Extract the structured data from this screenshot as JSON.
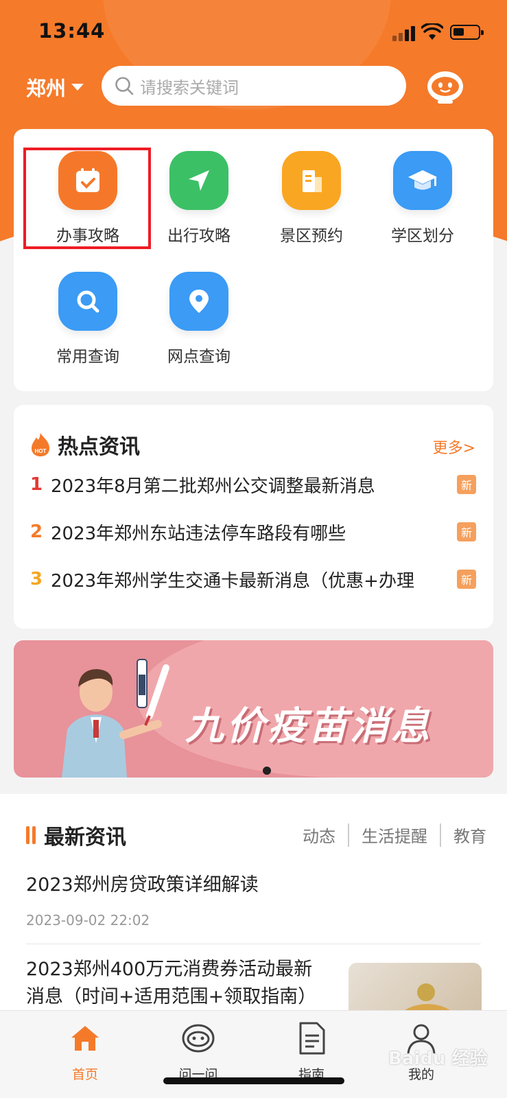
{
  "status": {
    "time": "13:44"
  },
  "header": {
    "city": "郑州",
    "search_placeholder": "请搜索关键词"
  },
  "services": [
    {
      "label": "办事攻略",
      "icon": "calendar-check-icon",
      "color": "#f5782a"
    },
    {
      "label": "出行攻略",
      "icon": "navigation-arrow-icon",
      "color": "#3cc066"
    },
    {
      "label": "景区预约",
      "icon": "building-icon",
      "color": "#f9a623"
    },
    {
      "label": "学区划分",
      "icon": "graduation-cap-icon",
      "color": "#3b9bf5"
    },
    {
      "label": "常用查询",
      "icon": "search-icon",
      "color": "#3b9bf5"
    },
    {
      "label": "网点查询",
      "icon": "location-pin-icon",
      "color": "#3b9bf5"
    }
  ],
  "hot_news": {
    "title": "热点资讯",
    "more": "更多>",
    "badge": "新",
    "items": [
      {
        "rank": "1",
        "text": "2023年8月第二批郑州公交调整最新消息",
        "rank_color": "#e53935"
      },
      {
        "rank": "2",
        "text": "2023年郑州东站违法停车路段有哪些",
        "rank_color": "#f47a2a"
      },
      {
        "rank": "3",
        "text": "2023年郑州学生交通卡最新消息（优惠+办理",
        "rank_color": "#f5a623"
      }
    ]
  },
  "banner": {
    "title": "九价疫苗消息"
  },
  "latest": {
    "title": "最新资讯",
    "tabs": [
      "动态",
      "生活提醒",
      "教育"
    ],
    "articles": [
      {
        "title": "2023郑州房贷政策详细解读",
        "time": "2023-09-02 22:02"
      },
      {
        "title": "2023郑州400万元消费券活动最新消息（时间+适用范围+领取指南）"
      }
    ]
  },
  "tabbar": {
    "items": [
      {
        "label": "首页",
        "icon": "home-icon"
      },
      {
        "label": "问一问",
        "icon": "robot-icon"
      },
      {
        "label": "指南",
        "icon": "document-icon"
      },
      {
        "label": "我的",
        "icon": "user-icon"
      }
    ]
  },
  "watermark": "Baidu 经验",
  "colors": {
    "brand_orange": "#f47a2a",
    "highlight_red": "#ee1c25"
  }
}
